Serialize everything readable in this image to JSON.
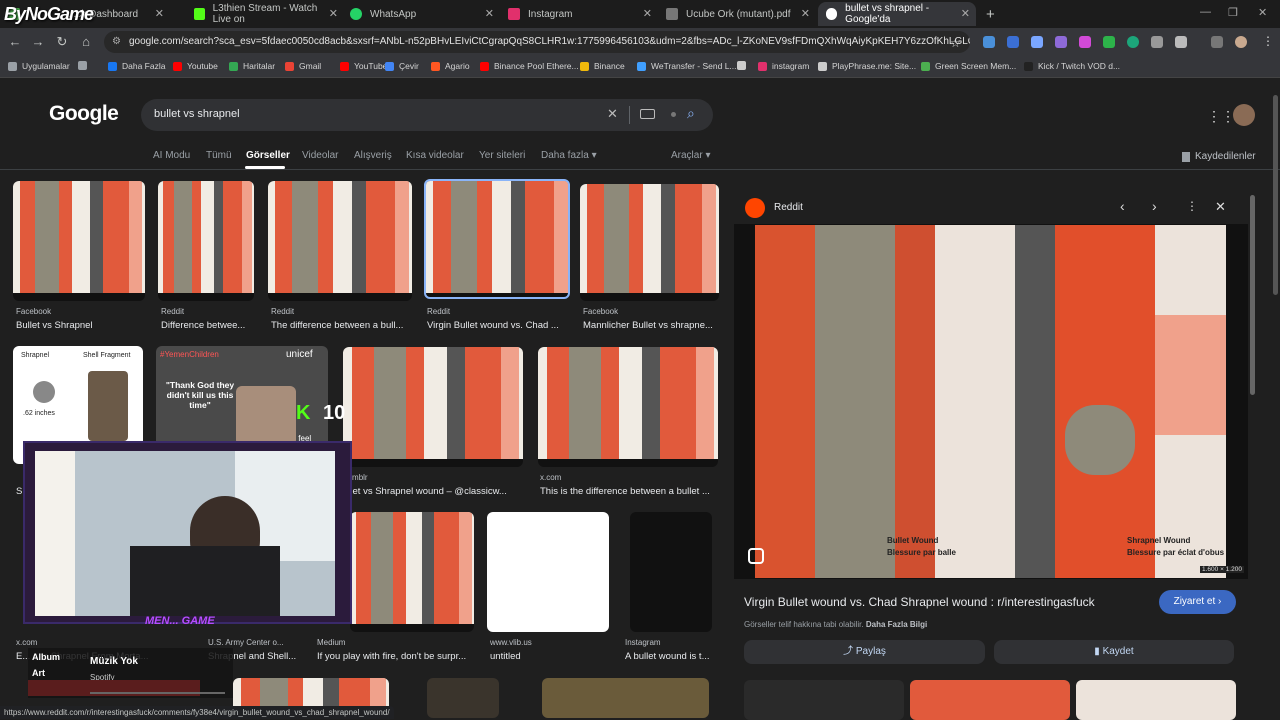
{
  "overlay_logo": "ByNoGame",
  "tabs": [
    {
      "label": "...ck Dashboard",
      "color": "#4caf50"
    },
    {
      "label": "L3thien Stream - Watch Live on",
      "color": "#53fc18"
    },
    {
      "label": "WhatsApp",
      "color": "#25d366"
    },
    {
      "label": "Instagram",
      "color": "#e1306c"
    },
    {
      "label": "Ucube Ork (mutant).pdf",
      "color": "#777777"
    },
    {
      "label": "bullet vs shrapnel - Google'da",
      "color": "#ffffff"
    }
  ],
  "new_tab": "+",
  "url": "google.com/search?sca_esv=5fdaec0050cd8acb&sxsrf=ANbL-n52pBHvLEIviCtCgrapQqS8CLHR1w:1775996456103&udm=2&fbs=ADc_l-ZKoNEV9sfFDmQXhWqAiyKpKEH7Y6zzOfKhLGLO6HgYJkSiw...",
  "bookmarks": [
    {
      "label": "Uygulamalar",
      "color": "#9aa0a6"
    },
    {
      "label": "",
      "color": "#9aa0a6"
    },
    {
      "label": "Daha Fazla",
      "color": "#1877f2"
    },
    {
      "label": "Youtube",
      "color": "#ff0000"
    },
    {
      "label": "Haritalar",
      "color": "#34a853"
    },
    {
      "label": "Gmail",
      "color": "#ea4335"
    },
    {
      "label": "YouTube",
      "color": "#ff0000"
    },
    {
      "label": "Çevir",
      "color": "#4285f4"
    },
    {
      "label": "Agario",
      "color": "#ff5722"
    },
    {
      "label": "Binance Pool Ethere...",
      "color": "#ff0000"
    },
    {
      "label": "Binance",
      "color": "#f0b90b"
    },
    {
      "label": "WeTransfer - Send L...",
      "color": "#409fff"
    },
    {
      "label": "",
      "color": "#cccccc"
    },
    {
      "label": "instagram",
      "color": "#e1306c"
    },
    {
      "label": "PlayPhrase.me: Site...",
      "color": "#cccccc"
    },
    {
      "label": "Green Screen Mem...",
      "color": "#4caf50"
    },
    {
      "label": "Kick / Twitch VOD d...",
      "color": "#222222"
    }
  ],
  "google_logo": "Google",
  "search_query": "bullet vs shrapnel",
  "search_tabs": [
    "AI Modu",
    "Tümü",
    "Görseller",
    "Videolar",
    "Alışveriş",
    "Kısa videolar",
    "Yer siteleri",
    "Daha fazla"
  ],
  "tools_label": "Araçlar",
  "saved_label": "Kaydedilenler",
  "results_row1": [
    {
      "source": "Facebook",
      "title": "Bullet vs Shrapnel"
    },
    {
      "source": "Reddit",
      "title": "Difference betwee..."
    },
    {
      "source": "Reddit",
      "title": "The difference between a bull..."
    },
    {
      "source": "Reddit",
      "title": "Virgin Bullet wound vs. Chad ..."
    },
    {
      "source": "Facebook",
      "title": "Mannlicher Bullet vs shrapne..."
    }
  ],
  "results_row2": [
    {
      "source": "",
      "title": "S"
    },
    {
      "source": "Tumblr",
      "title": "ullet vs Shrapnel wound – @classicw..."
    },
    {
      "source": "x.com",
      "title": "This is the difference between a bullet ..."
    }
  ],
  "results_row3": [
    {
      "source": "x.com",
      "title": "E... ...ts Shrapnel From Morta..."
    },
    {
      "source": "U.S. Army Center o...",
      "title": "Shrapnel and Shell..."
    },
    {
      "source": "Medium",
      "title": "If you play with fire, don't be surpr..."
    },
    {
      "source": "www.vlib.us",
      "title": "untitled"
    },
    {
      "source": "Instagram",
      "title": "A bullet wound is t..."
    }
  ],
  "row2_texts": {
    "shrapnel": "Shrapnel",
    "shell_fragment": "Shell Fragment",
    "inches": ".62 inches",
    "hashtag": "#YemenChildren",
    "unicef": "unicef",
    "quote": "\"Thank God they didn't kill us this time\"",
    "quote2": "\"I feel",
    "kick_num": "10"
  },
  "panel": {
    "source": "Reddit",
    "image_dims": "1.600 × 1.200",
    "label_left": "Bullet Wound",
    "label_left_fr": "Blessure par balle",
    "label_right": "Shrapnel Wound",
    "label_right_fr": "Blessure par éclat d'obus",
    "title": "Virgin Bullet wound vs. Chad Shrapnel wound : r/interestingasfuck",
    "visit_label": "Ziyaret et",
    "copyright_text": "Görseller telif hakkına tabi olabilir.",
    "more_info": "Daha Fazla Bilgi",
    "share_label": "Paylaş",
    "save_label": "Kaydet"
  },
  "music": {
    "album": "Album",
    "art": "Art",
    "title": "Müzik Yok",
    "app": "Spotify"
  },
  "webcam_text": "MEN... GAME",
  "status_url": "https://www.reddit.com/r/interestingasfuck/comments/fy38e4/virgin_bullet_wound_vs_chad_shrapnel_wound/"
}
